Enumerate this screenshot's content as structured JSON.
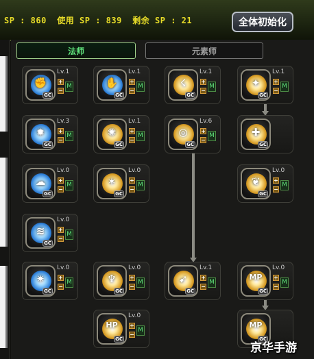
{
  "header": {
    "sp_label": "SP",
    "sp_value": "860",
    "used_label": "使用 SP",
    "used_value": "839",
    "remaining_label": "剩余 SP",
    "remaining_value": "21",
    "reset_button": "全体初始化"
  },
  "tabs": [
    {
      "label": "法师",
      "active": true
    },
    {
      "label": "元素师",
      "active": false
    }
  ],
  "skills": [
    {
      "id": "r1c1",
      "level": "Lv.1",
      "icon": "blue-fist-skill-icon",
      "color": "blue",
      "controls": true,
      "gc": true
    },
    {
      "id": "r1c2",
      "level": "Lv.1",
      "icon": "blue-claw-skill-icon",
      "color": "blue",
      "controls": true,
      "gc": true
    },
    {
      "id": "r1c3",
      "level": "Lv.1",
      "icon": "gold-kick-skill-icon",
      "color": "gold",
      "controls": true,
      "gc": true
    },
    {
      "id": "r1c4",
      "level": "Lv.1",
      "icon": "gold-bird-skill-icon",
      "color": "gold",
      "controls": true,
      "gc": true
    },
    {
      "id": "r2c1",
      "level": "Lv.3",
      "icon": "blue-burst-skill-icon",
      "color": "blue",
      "controls": true,
      "gc": true
    },
    {
      "id": "r2c2",
      "level": "Lv.1",
      "icon": "gold-flame-skill-icon",
      "color": "gold",
      "controls": true,
      "gc": true
    },
    {
      "id": "r2c3",
      "level": "Lv.6",
      "icon": "gold-ring-skill-icon",
      "color": "gold",
      "controls": true,
      "gc": true
    },
    {
      "id": "r2c4",
      "level": "",
      "icon": "gold-aid-skill-icon",
      "color": "gold",
      "controls": false,
      "gc": true
    },
    {
      "id": "r3c1",
      "level": "Lv.0",
      "icon": "blue-ghost-skill-icon",
      "color": "blue",
      "controls": true,
      "gc": true
    },
    {
      "id": "r3c2",
      "level": "Lv.0",
      "icon": "gold-pillar-skill-icon",
      "color": "gold",
      "controls": true,
      "gc": true
    },
    {
      "id": "r3c4",
      "level": "Lv.0",
      "icon": "gold-wing-skill-icon",
      "color": "gold",
      "controls": true,
      "gc": true
    },
    {
      "id": "r4c1",
      "level": "Lv.0",
      "icon": "blue-wave-skill-icon",
      "color": "blue",
      "controls": true,
      "gc": true
    },
    {
      "id": "r5c1",
      "level": "Lv.0",
      "icon": "blue-storm-skill-icon",
      "color": "blue",
      "controls": true,
      "gc": true
    },
    {
      "id": "r5c2",
      "level": "Lv.0",
      "icon": "gold-figure-skill-icon",
      "color": "gold",
      "controls": true,
      "gc": true
    },
    {
      "id": "r5c3",
      "level": "Lv.1",
      "icon": "gold-run-skill-icon",
      "color": "gold",
      "controls": true,
      "gc": true
    },
    {
      "id": "r5c4",
      "level": "Lv.0",
      "icon": "gold-mp-skill-icon",
      "color": "gold",
      "controls": true,
      "gc": true
    },
    {
      "id": "r6c2",
      "level": "Lv.0",
      "icon": "gold-hp-skill-icon",
      "color": "gold",
      "controls": true,
      "gc": true
    },
    {
      "id": "r6c4",
      "level": "",
      "icon": "gold-mp2-skill-icon",
      "color": "gold",
      "controls": false,
      "gc": true
    }
  ],
  "control_labels": {
    "plus": "+",
    "minus": "−",
    "master": "M",
    "gc": "GC"
  },
  "icon_glyphs": {
    "blue-fist-skill-icon": "✊",
    "blue-claw-skill-icon": "✋",
    "gold-kick-skill-icon": "☇",
    "gold-bird-skill-icon": "✦",
    "blue-burst-skill-icon": "✹",
    "gold-flame-skill-icon": "✺",
    "gold-ring-skill-icon": "◎",
    "gold-aid-skill-icon": "✚",
    "blue-ghost-skill-icon": "☁",
    "gold-pillar-skill-icon": "✶",
    "gold-wing-skill-icon": "❦",
    "blue-wave-skill-icon": "≋",
    "blue-storm-skill-icon": "✷",
    "gold-figure-skill-icon": "♆",
    "gold-run-skill-icon": "➹",
    "gold-mp-skill-icon": "MP",
    "gold-hp-skill-icon": "HP",
    "gold-mp2-skill-icon": "MP"
  },
  "watermark": "京华手游",
  "colors": {
    "accent_text": "#e8dc28",
    "active_tab": "#5fe07a",
    "blue_skill": "#2d7fd8",
    "gold_skill": "#d69a22"
  }
}
